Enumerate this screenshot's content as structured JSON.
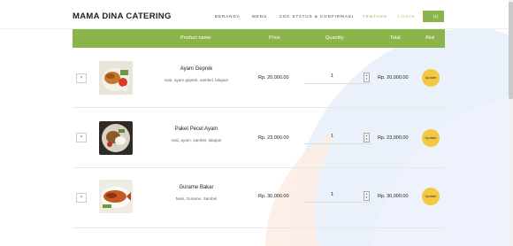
{
  "header": {
    "brand": "MAMA DINA CATERING",
    "nav": [
      "BERANDA",
      "MENU",
      "CEK STATUS & KONFIRMASI",
      "TENTANG",
      "LOGIN"
    ],
    "cart_label": "🛒(1)"
  },
  "table": {
    "columns": [
      "Product name",
      "Price",
      "Quantity",
      "Total",
      "Aksi"
    ],
    "rows": [
      {
        "name": "Ayam Geprek",
        "desc": "nasi, ayam geprek, sambel, lalapan",
        "price": "Rp. 20,000.00",
        "qty": "1",
        "total": "Rp. 20,000.00",
        "remove": "×",
        "action": "Update"
      },
      {
        "name": "Paket Pecel Ayam",
        "desc": "nasi, ayam, sambel, lalapan",
        "price": "Rp. 23,000.00",
        "qty": "1",
        "total": "Rp. 23,000.00",
        "remove": "×",
        "action": "Update"
      },
      {
        "name": "Gurame Bakar",
        "desc": "Nasi, Gurame, Sambel",
        "price": "Rp. 30,000.00",
        "qty": "1",
        "total": "Rp. 30,000.00",
        "remove": "×",
        "action": "Update"
      }
    ]
  },
  "colors": {
    "accent": "#8bb54a",
    "update": "#f5c842"
  }
}
